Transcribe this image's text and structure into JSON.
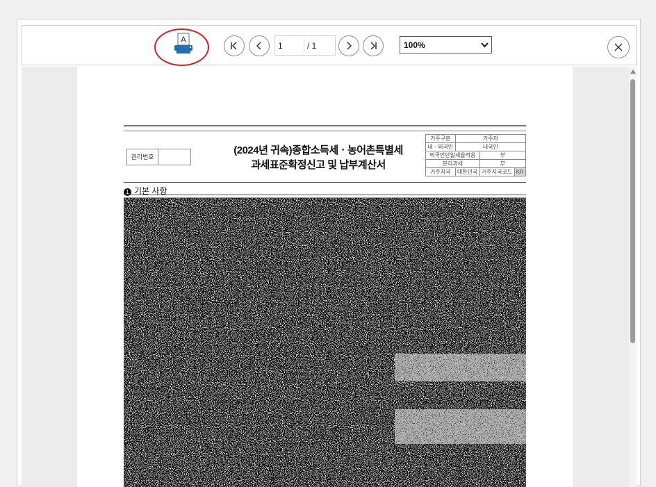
{
  "toolbar": {
    "print_icon_letter": "A",
    "page_current": "1",
    "page_total": "/ 1",
    "zoom": "100%",
    "zoom_options": [
      "100%"
    ]
  },
  "document": {
    "mgmt_label": "관리번호",
    "title_line1": "(2024년 귀속)종합소득세ㆍ농어촌특별세",
    "title_line2": "과세표준확정신고 및 납부계산서",
    "info": {
      "r1c1": "거주구분",
      "r1c2": "거주자",
      "r2c1": "내ㆍ외국인",
      "r2c2": "내국인",
      "r3c1": "외국인단일세율적용",
      "r3c2": "부",
      "r4c1": "분리과세",
      "r4c2": "부",
      "r5c1": "거주지국",
      "r5c2": "대한민국",
      "r5c3": "거주지국코드",
      "r5c4": "KR"
    },
    "section_number": "1",
    "section_label": "기본 사항"
  },
  "colors": {
    "highlight": "#d62020",
    "scroll_thumb": "#9a9a9a"
  },
  "icons": [
    "print-icon",
    "first-page-icon",
    "prev-page-icon",
    "next-page-icon",
    "last-page-icon",
    "close-icon",
    "chevron-down-icon"
  ]
}
